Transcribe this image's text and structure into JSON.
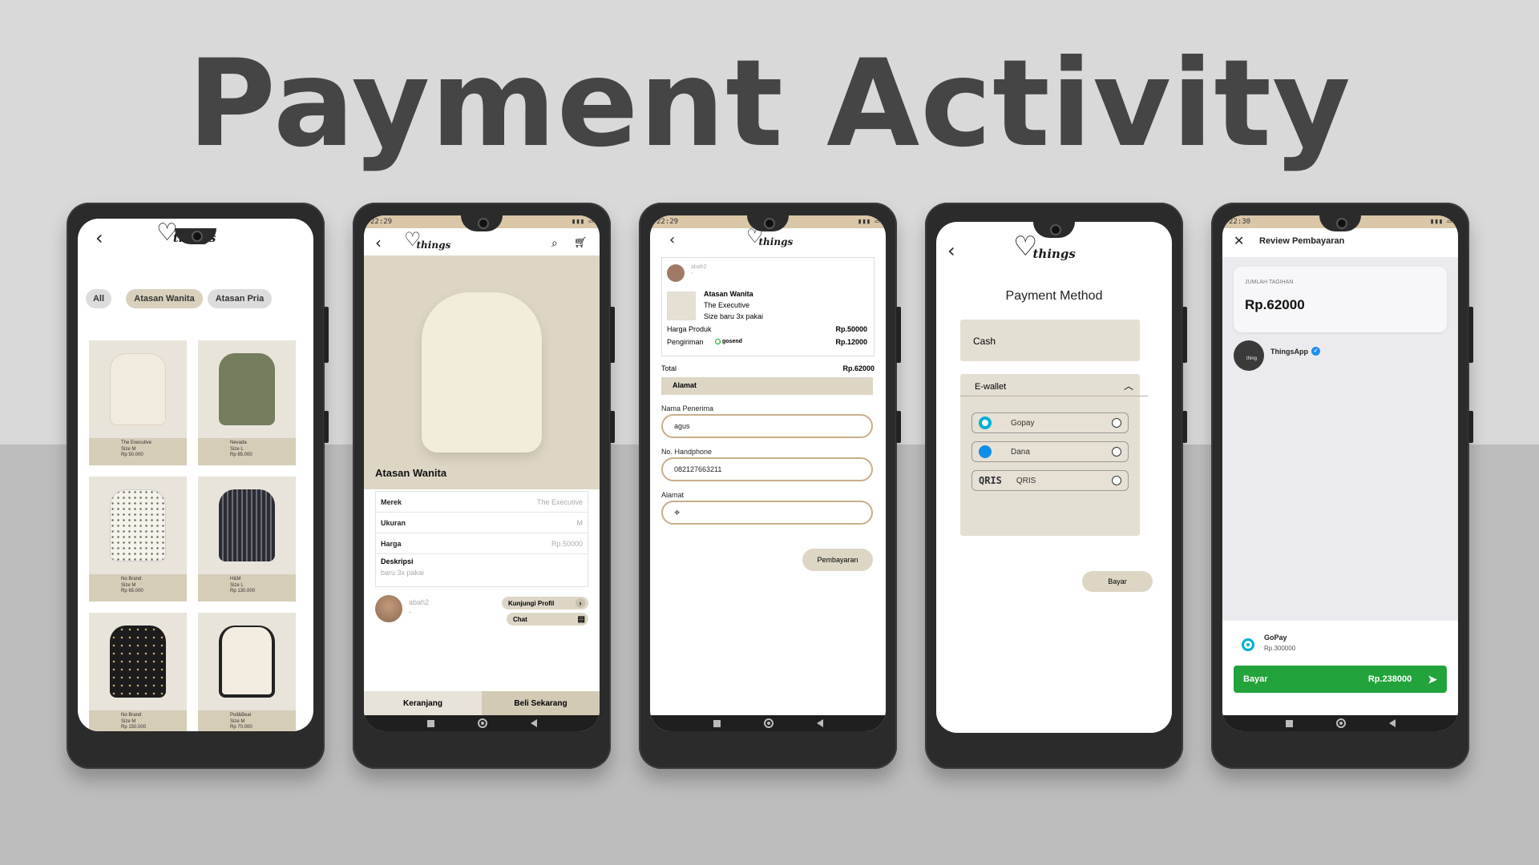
{
  "headline": "Payment Activity",
  "colors": {
    "accent_beige": "#d9d0bd",
    "pay_green": "#22a33b",
    "border_tan": "#c9ad8a"
  },
  "brand": {
    "logo_word": "things"
  },
  "phone1": {
    "filters": [
      "All",
      "Atasan Wanita",
      "Atasan Pria"
    ],
    "products": [
      {
        "name": "The Executive",
        "size": "Size M",
        "price": "Rp 50.000"
      },
      {
        "name": "Nevada",
        "size": "Size L",
        "price": "Rp 85.000"
      },
      {
        "name": "No Brand",
        "size": "Size M",
        "price": "Rp 65.000"
      },
      {
        "name": "H&M",
        "size": "Size L",
        "price": "Rp 130.000"
      },
      {
        "name": "No Brand",
        "size": "Size M",
        "price": "Rp 150.000"
      },
      {
        "name": "Pull&Bear",
        "size": "Size M",
        "price": "Rp 70.000"
      }
    ]
  },
  "phone2": {
    "status_time": "22:29",
    "title": "Atasan Wanita",
    "details": [
      {
        "label": "Merek",
        "value": "The Executive"
      },
      {
        "label": "Ukuran",
        "value": "M"
      },
      {
        "label": "Harga",
        "value": "Rp.50000"
      }
    ],
    "desc_label": "Deskripsi",
    "desc_value": "baru 3x pakai",
    "seller_name": "abah2",
    "seller_sub": "-",
    "visit_profile": "Kunjungi Profil",
    "chat": "Chat",
    "cart_button": "Keranjang",
    "buy_button": "Beli Sekarang"
  },
  "phone3": {
    "status_time": "22:29",
    "seller_name": "abah2",
    "seller_sub": "-",
    "item_title": "Atasan Wanita",
    "item_brand": "The Executive",
    "item_desc": "Size baru 3x pakai",
    "price_label": "Harga Produk",
    "price_value": "Rp.50000",
    "ship_label": "Pengiriman",
    "ship_provider": "gosend",
    "ship_value": "Rp.12000",
    "total_label": "Total",
    "total_value": "Rp.62000",
    "address_section": "Alamat",
    "recipient_label": "Nama Penerima",
    "recipient_value": "agus",
    "phone_label": "No. Handphone",
    "phone_value": "082127663211",
    "address_label": "Alamat",
    "pay_button": "Pembayaran"
  },
  "phone4": {
    "title": "Payment Method",
    "cash": "Cash",
    "ewallet": "E-wallet",
    "options": [
      "Gopay",
      "Dana",
      "QRIS"
    ],
    "qris_logo": "QRIS",
    "pay_button": "Bayar"
  },
  "phone5": {
    "status_time": "22:30",
    "title": "Review Pembayaran",
    "bill_label": "JUMLAH TAGIHAN",
    "bill_amount": "Rp.62000",
    "merchant": "ThingsApp",
    "merchant_avatar_text": "thing",
    "wallet_name": "GoPay",
    "wallet_balance": "Rp.300000",
    "pay_label": "Bayar",
    "pay_amount": "Rp.238000"
  }
}
